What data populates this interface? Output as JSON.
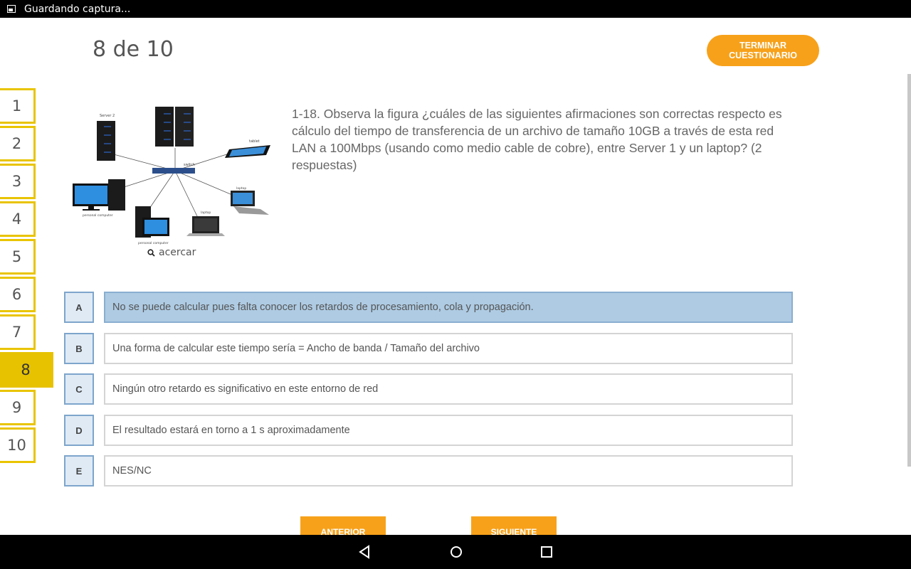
{
  "status_bar": {
    "text": "Guardando captura...",
    "icon": "image-icon"
  },
  "header": {
    "counter": "8 de 10",
    "finish_label": "TERMINAR CUESTIONARIO"
  },
  "question_nav": {
    "items": [
      "1",
      "2",
      "3",
      "4",
      "5",
      "6",
      "7",
      "8",
      "9",
      "10"
    ],
    "active": "8"
  },
  "figure": {
    "labels": {
      "server2": "Server 2",
      "switch": "switch",
      "tablet": "tablet",
      "laptop1": "laptop",
      "laptop2": "laptop",
      "pc1": "personal computer",
      "pc2": "personal computer"
    },
    "zoom_label": "acercar"
  },
  "question": {
    "text": "1-18. Observa la figura ¿cuáles de las siguientes afirmaciones son correctas respecto es cálculo  del tiempo de transferencia de un archivo de tamaño 10GB a través de esta red LAN a 100Mbps (usando como medio cable de cobre), entre Server 1 y un laptop? (2 respuestas)"
  },
  "options": [
    {
      "letter": "A",
      "text": "No se puede calcular pues falta conocer los retardos de procesamiento, cola y propagación.",
      "selected": true
    },
    {
      "letter": "B",
      "text": "Una forma de calcular este tiempo sería = Ancho de banda / Tamaño del archivo",
      "selected": false
    },
    {
      "letter": "C",
      "text": "Ningún otro retardo es significativo en este entorno de red",
      "selected": false
    },
    {
      "letter": "D",
      "text": "El resultado estará en torno a 1 s aproximadamente",
      "selected": false
    },
    {
      "letter": "E",
      "text": "NES/NC",
      "selected": false
    }
  ],
  "footer": {
    "prev_label": "ANTERIOR",
    "next_label": "SIGUIENTE"
  },
  "colors": {
    "accent_orange": "#f7a11a",
    "nav_yellow": "#e6c200",
    "selected_blue": "#aecbe3"
  }
}
